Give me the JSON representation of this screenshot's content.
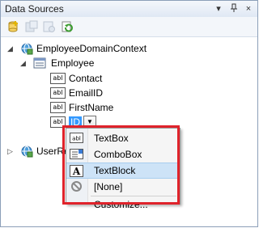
{
  "panel": {
    "title": "Data Sources",
    "pin_glyph": "ꟷ",
    "close_glyph": "×",
    "dropdown_glyph": "▾"
  },
  "toolbar": {
    "buttons": [
      {
        "name": "add-new-data-source-icon"
      },
      {
        "name": "edit-dataset-icon",
        "disabled": true
      },
      {
        "name": "configure-dataset-icon",
        "disabled": true
      },
      {
        "name": "refresh-icon"
      }
    ]
  },
  "tree": {
    "context": "EmployeeDomainContext",
    "entity": "Employee",
    "fields": [
      "Contact",
      "EmailID",
      "FirstName"
    ],
    "selected_field": "ID",
    "truncated_item": "UserRe",
    "abl_glyph": "abl"
  },
  "menu": {
    "items": [
      {
        "label": "TextBox",
        "icon": "textbox-icon"
      },
      {
        "label": "ComboBox",
        "icon": "combobox-icon"
      },
      {
        "label": "TextBlock",
        "icon": "textblock-icon",
        "highlighted": true
      },
      {
        "label": "[None]",
        "icon": "none-icon"
      },
      {
        "label": "Customize...",
        "icon": ""
      }
    ]
  },
  "colors": {
    "highlight_border": "#e0232b",
    "selection": "#3399ff",
    "menu_hover": "#cde3f7"
  }
}
